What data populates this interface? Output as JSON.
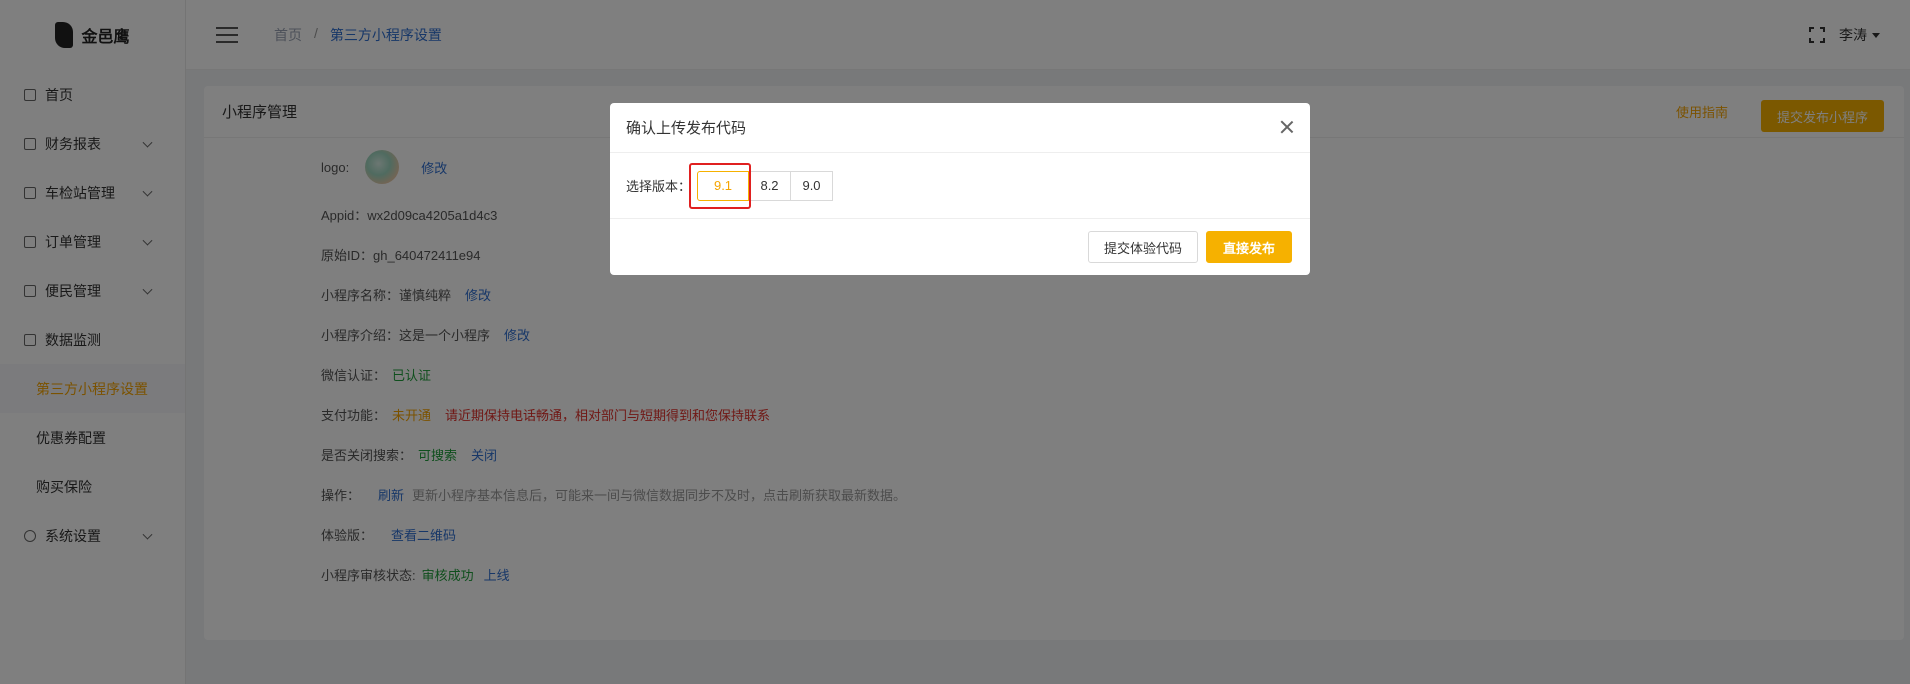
{
  "app": {
    "logo_text": "金邑鹰"
  },
  "sidebar": {
    "items": [
      {
        "label": "首页"
      },
      {
        "label": "财务报表"
      },
      {
        "label": "车检站管理"
      },
      {
        "label": "订单管理"
      },
      {
        "label": "便民管理"
      },
      {
        "label": "数据监测"
      },
      {
        "label": "第三方小程序设置"
      },
      {
        "label": "优惠券配置"
      },
      {
        "label": "购买保险"
      },
      {
        "label": "系统设置"
      }
    ]
  },
  "header": {
    "breadcrumb": {
      "home": "首页",
      "separator": "/",
      "current": "第三方小程序设置"
    },
    "user": "李涛"
  },
  "card": {
    "title": "小程序管理",
    "guide": "使用指南",
    "publish_button": "提交发布小程序",
    "logo_label": "logo:",
    "modify": "修改",
    "appid": "Appid：wx2d09ca4205a1d4c3",
    "original_id": "原始ID：gh_640472411e94",
    "name_label": "小程序名称：谨慎纯粹",
    "intro_label": "小程序介绍：这是一个小程序",
    "wechat_auth_label": "微信认证：",
    "wechat_auth_value": "已认证",
    "payment_label": "支付功能：",
    "payment_value": "未开通",
    "payment_note": "请近期保持电话畅通，相对部门与短期得到和您保持联系",
    "search_label": "是否关闭搜索：",
    "search_value": "可搜索",
    "search_close": "关闭",
    "action_label": "操作：",
    "action_refresh": "刷新",
    "action_note": "更新小程序基本信息后，可能来一间与微信数据同步不及时，点击刷新获取最新数据。",
    "trial_label": "体验版：",
    "trial_link": "查看二维码",
    "review_label": "小程序审核状态:",
    "review_value": "审核成功",
    "review_online": "上线"
  },
  "modal": {
    "title": "确认上传发布代码",
    "version_label": "选择版本：",
    "versions": [
      "9.1",
      "8.2",
      "9.0"
    ],
    "selected_version": "9.1",
    "submit_trial_button": "提交体验代码",
    "publish_direct_button": "直接发布"
  },
  "colors": {
    "accent": "#f6b100",
    "link": "#2f6fd1",
    "success": "#1e9e3a",
    "danger": "#e0312b"
  }
}
